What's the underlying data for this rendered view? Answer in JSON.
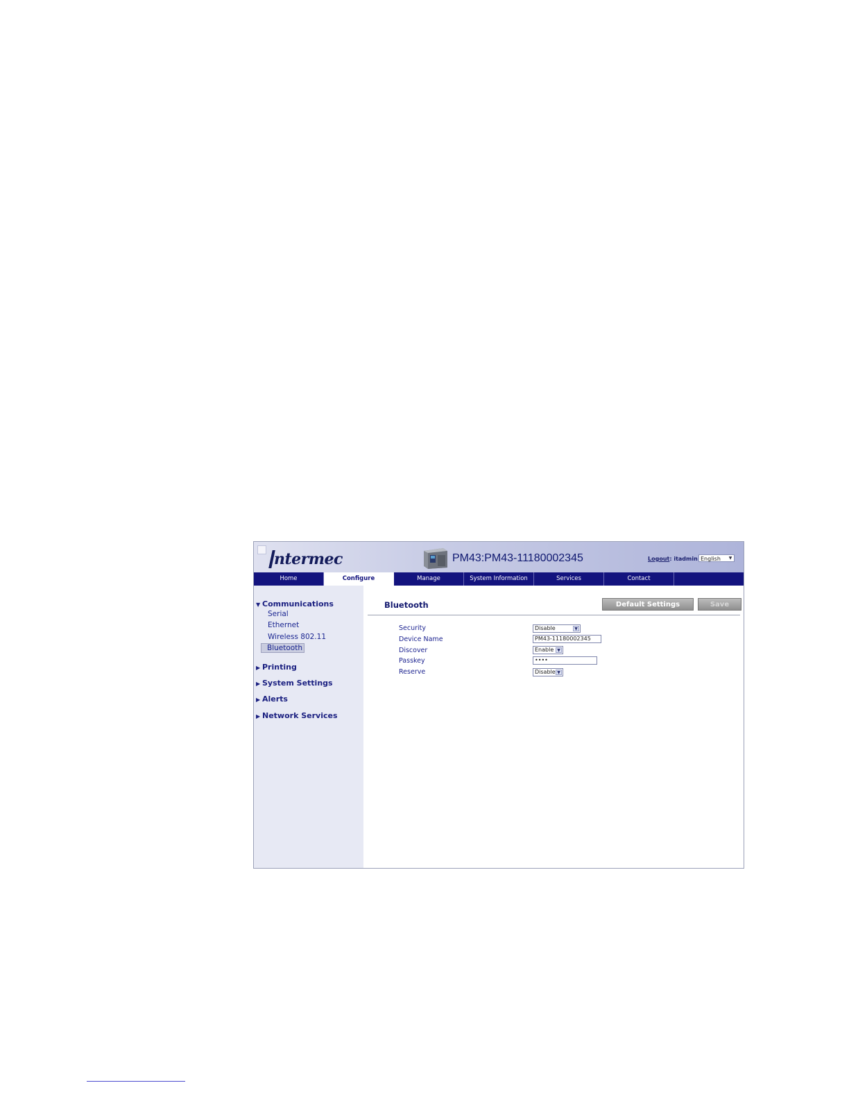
{
  "header": {
    "logo_text": "ntermec",
    "device_title": "PM43:PM43-11180002345",
    "logout_label": "Logout",
    "logout_user": ": itadmin",
    "language": "English"
  },
  "nav": {
    "tabs": [
      {
        "label": "Home"
      },
      {
        "label": "Configure"
      },
      {
        "label": "Manage"
      },
      {
        "label": "System Information"
      },
      {
        "label": "Services"
      },
      {
        "label": "Contact"
      }
    ]
  },
  "sidebar": {
    "communications": "Communications",
    "sub_items": [
      "Serial",
      "Ethernet",
      "Wireless 802.11",
      "Bluetooth"
    ],
    "printing": "Printing",
    "system_settings": "System Settings",
    "alerts": "Alerts",
    "network_services": "Network Services"
  },
  "content": {
    "title": "Bluetooth",
    "default_settings_label": "Default Settings",
    "save_label": "Save",
    "fields": {
      "security": {
        "label": "Security",
        "value": "Disable"
      },
      "device_name": {
        "label": "Device Name",
        "value": "PM43-11180002345"
      },
      "discover": {
        "label": "Discover",
        "value": "Enable"
      },
      "passkey": {
        "label": "Passkey",
        "value": "••••"
      },
      "reserve": {
        "label": "Reserve",
        "value": "Disable"
      }
    }
  }
}
